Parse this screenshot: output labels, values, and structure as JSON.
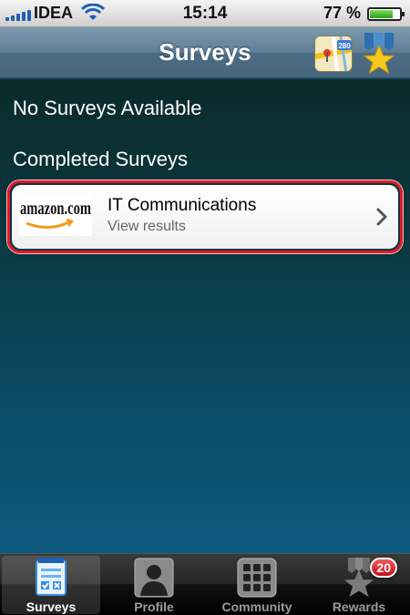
{
  "status_bar": {
    "carrier": "IDEA",
    "time": "15:14",
    "battery_percent": "77 %",
    "battery_level": 0.77
  },
  "nav": {
    "title": "Surveys",
    "left_icon": "map-icon",
    "right_icon": "medal-star-icon"
  },
  "content": {
    "no_surveys_text": "No Surveys Available",
    "completed_heading": "Completed Surveys",
    "completed_surveys": [
      {
        "brand": "amazon.com",
        "title": "IT Communications",
        "subtitle": "View results",
        "highlight_color": "#e01a2a"
      }
    ]
  },
  "tab_bar": {
    "tabs": [
      {
        "label": "Surveys",
        "icon": "clipboard-icon",
        "active": true
      },
      {
        "label": "Profile",
        "icon": "person-icon",
        "active": false
      },
      {
        "label": "Community",
        "icon": "grid-icon",
        "active": false
      },
      {
        "label": "Rewards",
        "icon": "medal-icon",
        "active": false,
        "badge": "20"
      }
    ]
  },
  "colors": {
    "nav_bar": "#5f7e95",
    "accent_red": "#e01a2a",
    "content_bg_top": "#0b2a2c",
    "content_bg_bottom": "#0d5a80"
  }
}
